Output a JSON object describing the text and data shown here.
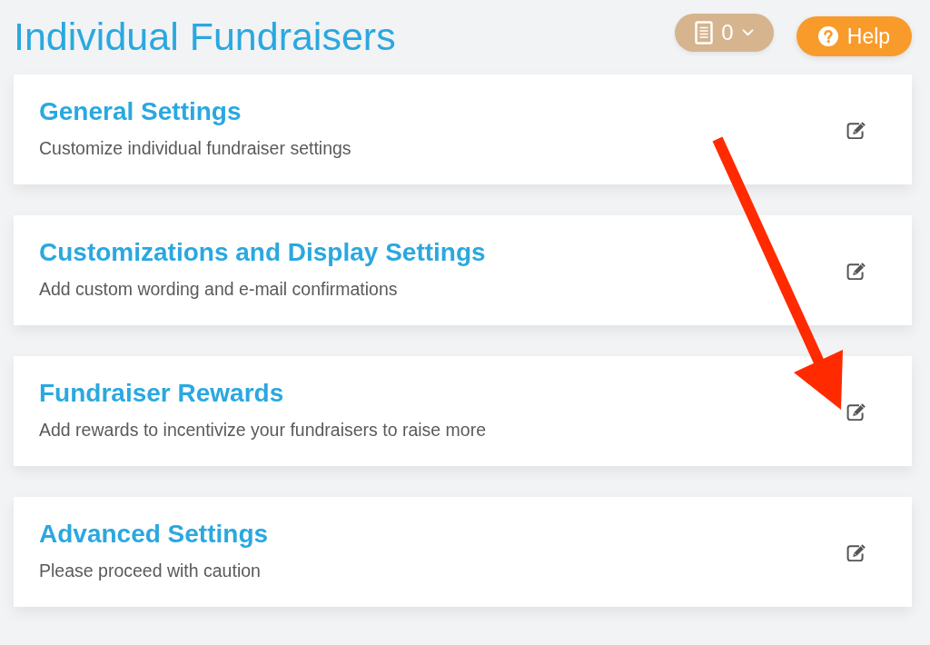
{
  "page": {
    "title": "Individual Fundraisers"
  },
  "toolbar": {
    "list_dropdown": {
      "count": "0"
    },
    "help_button": {
      "label": "Help"
    }
  },
  "sections": [
    {
      "title": "General Settings",
      "description": "Customize individual fundraiser settings"
    },
    {
      "title": "Customizations and Display Settings",
      "description": "Add custom wording and e-mail confirmations"
    },
    {
      "title": "Fundraiser Rewards",
      "description": "Add rewards to incentivize your fundraisers to raise more"
    },
    {
      "title": "Advanced Settings",
      "description": "Please proceed with caution"
    }
  ]
}
